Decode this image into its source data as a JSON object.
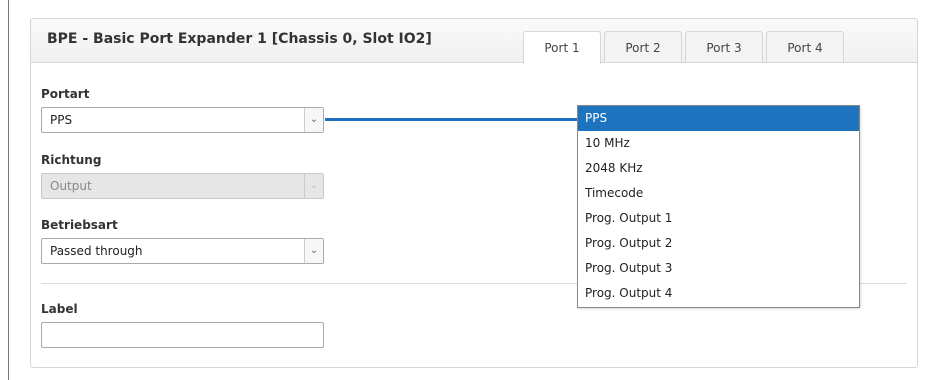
{
  "panel": {
    "title": "BPE - Basic Port Expander 1 [Chassis 0, Slot IO2]",
    "tabs": [
      {
        "label": "Port 1",
        "active": true
      },
      {
        "label": "Port 2",
        "active": false
      },
      {
        "label": "Port 3",
        "active": false
      },
      {
        "label": "Port 4",
        "active": false
      }
    ]
  },
  "form": {
    "portart": {
      "label": "Portart",
      "value": "PPS"
    },
    "richtung": {
      "label": "Richtung",
      "value": "Output",
      "disabled": true
    },
    "betriebsart": {
      "label": "Betriebsart",
      "value": "Passed through"
    },
    "label_field": {
      "label": "Label",
      "value": ""
    }
  },
  "dropdown": {
    "selected_index": 0,
    "options": [
      "PPS",
      "10 MHz",
      "2048 KHz",
      "Timecode",
      "Prog. Output 1",
      "Prog. Output 2",
      "Prog. Output 3",
      "Prog. Output 4"
    ]
  },
  "icons": {
    "select_arrow": "chevron-down-icon"
  },
  "colors": {
    "accent": "#1e73be",
    "connector": "#1e6fc0",
    "panel_border": "#d6d6d6"
  }
}
